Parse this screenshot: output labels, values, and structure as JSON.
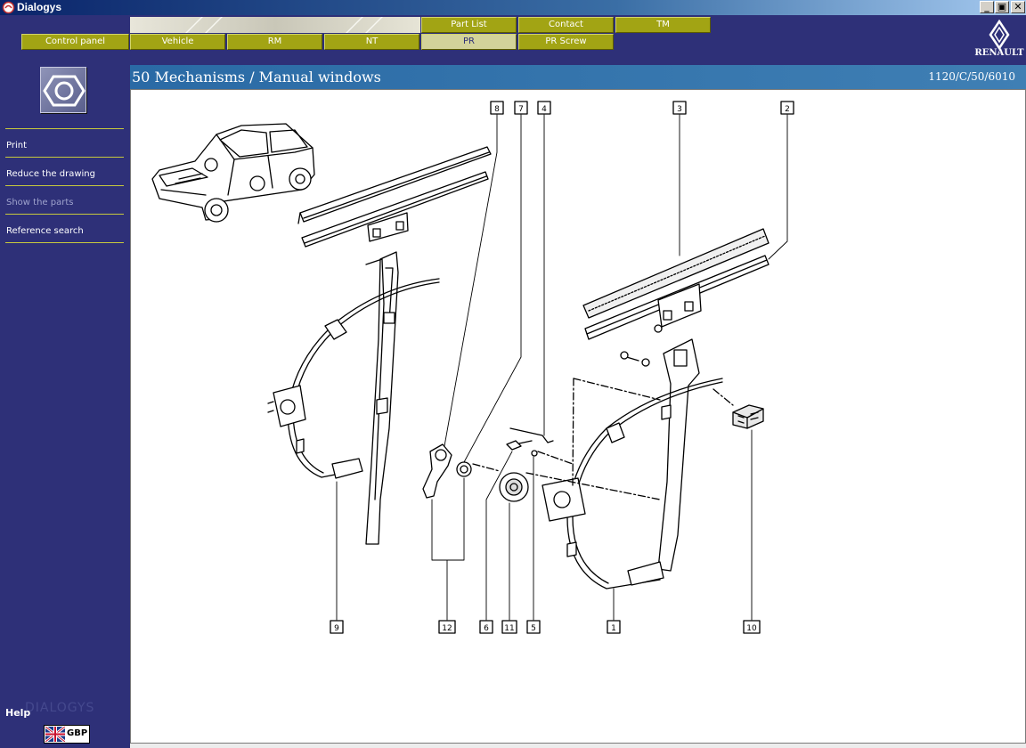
{
  "window": {
    "title": "Dialogys",
    "minimize": "_",
    "restore": "▣",
    "close": "✕"
  },
  "topnav": {
    "row1": [
      {
        "label": "Part List"
      },
      {
        "label": "Contact"
      },
      {
        "label": "TM"
      }
    ],
    "row2": [
      {
        "label": "Control panel"
      },
      {
        "label": "Vehicle"
      },
      {
        "label": "RM"
      },
      {
        "label": "NT"
      },
      {
        "label": "PR",
        "active": true
      },
      {
        "label": "PR Screw"
      }
    ],
    "accent": "#a2a414"
  },
  "brand": {
    "name": "RENAULT"
  },
  "sidebar": {
    "items": [
      {
        "label": "Print",
        "enabled": true
      },
      {
        "label": "Reduce the drawing",
        "enabled": true
      },
      {
        "label": "Show the parts",
        "enabled": false
      },
      {
        "label": "Reference search",
        "enabled": true
      }
    ],
    "help": "Help",
    "watermark": "DIALOGYS",
    "language": "GBP"
  },
  "header": {
    "title": "50 Mechanisms / Manual windows",
    "reference": "1120/C/50/6010"
  },
  "drawing": {
    "callouts": [
      "8",
      "7",
      "4",
      "3",
      "2",
      "9",
      "12",
      "6",
      "11",
      "5",
      "1",
      "10"
    ]
  }
}
